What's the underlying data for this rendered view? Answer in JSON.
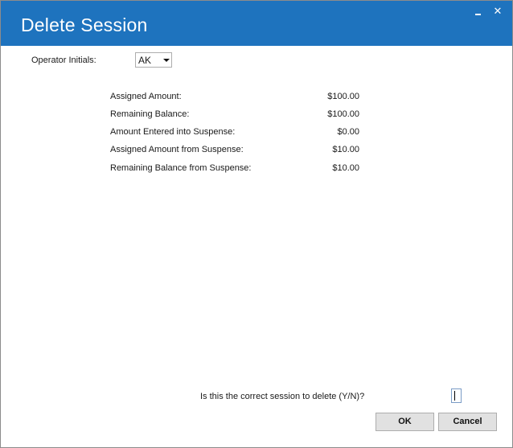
{
  "window": {
    "title": "Delete Session",
    "controls": {
      "minimize_icon": "minimize-icon",
      "close_icon": "close-icon",
      "close_glyph": "✕"
    },
    "titlebar_color": "#1e73be"
  },
  "operator": {
    "label": "Operator Initials:",
    "selected_value": "AK",
    "dropdown_icon": "chevron-down-icon"
  },
  "summary": {
    "rows": [
      {
        "label": "Assigned Amount:",
        "value": "$100.00"
      },
      {
        "label": "Remaining Balance:",
        "value": "$100.00"
      },
      {
        "label": "Amount Entered into Suspense:",
        "value": "$0.00"
      },
      {
        "label": "Assigned Amount from Suspense:",
        "value": "$10.00"
      },
      {
        "label": "Remaining Balance from Suspense:",
        "value": "$10.00"
      }
    ]
  },
  "confirm": {
    "prompt": "Is this the correct session to delete (Y/N)?",
    "input_value": ""
  },
  "buttons": {
    "ok_label": "OK",
    "cancel_label": "Cancel"
  }
}
